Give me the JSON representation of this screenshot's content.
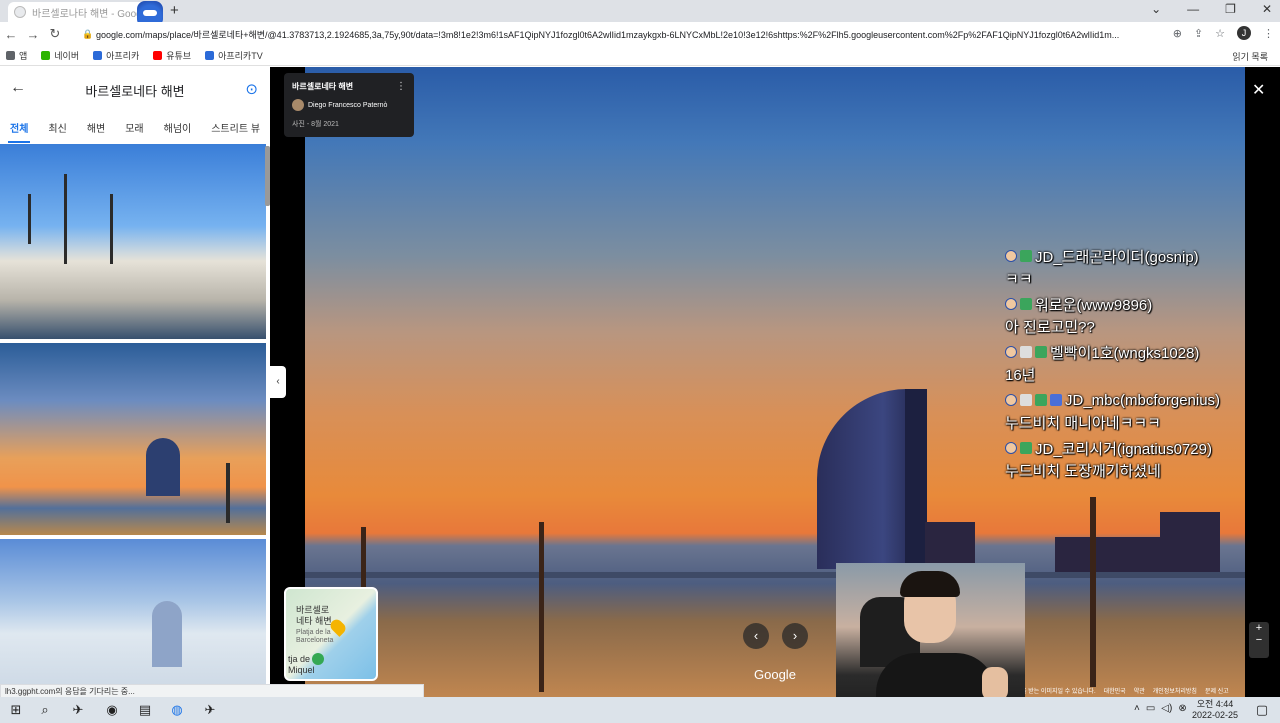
{
  "browser": {
    "tab_title": "바르셀로나타 해변 - Google 지도",
    "url": "google.com/maps/place/바르셀로네타+해변/@41.3783713,2.1924685,3a,75y,90t/data=!3m8!1e2!3m6!1sAF1QipNYJ1fozgl0t6A2wlIid1mzaykgxb-6LNYCxMbL!2e10!3e12!6shttps:%2F%2Flh5.googleusercontent.com%2Fp%2FAF1QipNYJ1fozgl0t6A2wlIid1m...",
    "profile_initial": "J",
    "bookmarks": [
      {
        "label": "앱",
        "color": "#5f6368"
      },
      {
        "label": "네이버",
        "color": "#2db400"
      },
      {
        "label": "아프리카",
        "color": "#2b6ad8"
      },
      {
        "label": "유튜브",
        "color": "#ff0000"
      },
      {
        "label": "아프리카TV",
        "color": "#2b6ad8"
      }
    ],
    "reading_list": "읽기 목록"
  },
  "left_panel": {
    "title": "바르셀로네타 해변",
    "tabs": [
      "전체",
      "최신",
      "해변",
      "모래",
      "해넘이",
      "스트리트 뷰"
    ],
    "active_tab": "전체"
  },
  "photo_card": {
    "title": "바르셀로네타 해변",
    "author": "Diego Francesco Paternò",
    "date": "사진 - 8월 2021"
  },
  "minimap": {
    "line1a": "바르셀로",
    "line1b": "네타 해변",
    "line2a": "Platja de la",
    "line2b": "Barceloneta",
    "line3a": "tja de",
    "line3b": "Miquel"
  },
  "viewer": {
    "google_label": "Google",
    "footer": [
      "보호을 받는 이미지일 수 있습니다.",
      "대한민국",
      "약관",
      "개인정보처리방침",
      "문제 신고"
    ]
  },
  "status_text": "lh3.ggpht.com의 응답을 기다리는 중...",
  "chat": [
    {
      "user": "JD_드래곤라이더(gosnip)",
      "text": "ㅋㅋ",
      "badges": [
        "face",
        "green"
      ]
    },
    {
      "user": "워로운(www9896)",
      "text": "아 진로고민??",
      "badges": [
        "face",
        "green"
      ]
    },
    {
      "user": "벨빡이1호(wngks1028)",
      "text": "16년",
      "badges": [
        "face",
        "gray",
        "green"
      ]
    },
    {
      "user": "JD_mbc(mbcforgenius)",
      "text": "누드비치 매니아네ㅋㅋㅋ",
      "badges": [
        "face",
        "gray",
        "green",
        "blue"
      ]
    },
    {
      "user": "JD_코리시거(ignatius0729)",
      "text": "누드비치 도장깨기하셨네",
      "badges": [
        "face",
        "green"
      ]
    }
  ],
  "taskbar": {
    "time": "오전 4:44",
    "date": "2022-02-25"
  }
}
